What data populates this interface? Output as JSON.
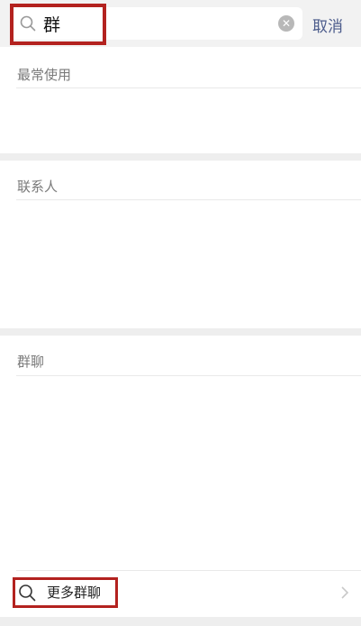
{
  "search": {
    "value": "群",
    "cancel_label": "取消"
  },
  "sections": {
    "frequent": {
      "title": "最常使用"
    },
    "contacts": {
      "title": "联系人"
    },
    "groups": {
      "title": "群聊"
    }
  },
  "more_groups": {
    "label": "更多群聊"
  },
  "colors": {
    "highlight": "#b3221f",
    "link_text": "#4b5b8b",
    "divider": "#e9e9e9"
  },
  "icons": [
    "search-icon",
    "clear-icon",
    "chevron-right-icon"
  ]
}
